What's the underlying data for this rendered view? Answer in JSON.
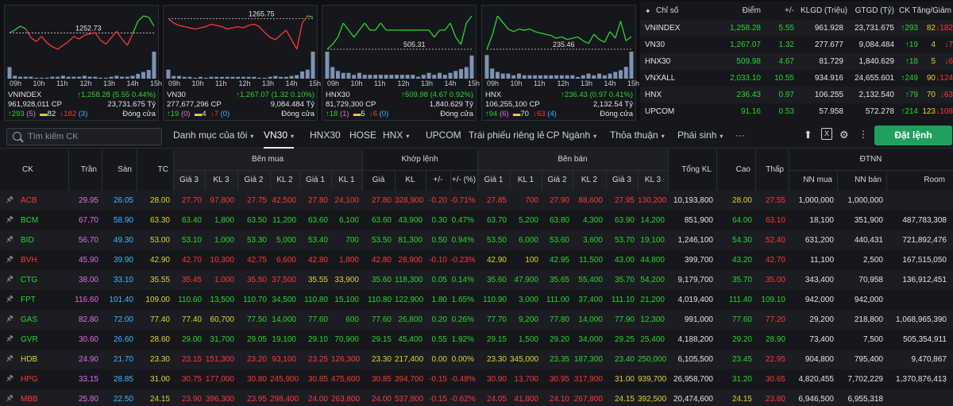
{
  "minis": [
    {
      "name": "VNINDEX",
      "line_values": [
        1252.73,
        1255,
        1258,
        1256,
        1249,
        1246,
        1250,
        1245,
        1242,
        1240,
        1243,
        1246,
        1250,
        1248,
        1251,
        1252,
        1253,
        1247,
        1244,
        1249,
        1254,
        1248,
        1243,
        1252,
        1262,
        1266,
        1265,
        1258
      ],
      "ref_value": 1252.73,
      "ref_label": "1252.73",
      "vol_values": [
        12,
        3,
        2,
        2,
        2,
        1,
        1,
        1,
        2,
        2,
        3,
        2,
        2,
        2,
        3,
        2,
        2,
        1,
        1,
        2,
        3,
        2,
        2,
        3,
        5,
        7,
        9,
        28
      ],
      "hours": [
        "09h",
        "10h",
        "11h",
        "12h",
        "13h",
        "14h",
        "15h"
      ],
      "row1_left": "VNINDEX",
      "row1_right": "↑1,258.28 (5.55 0.44%)",
      "row2_left": "961,928,011 CP",
      "row2_right": "23,731.675 Tỷ",
      "up": "↑293",
      "up_ce": "(5)",
      "ref": "82",
      "dn": "↓182",
      "dn_fl": "(3)",
      "status": "Đóng cửa"
    },
    {
      "name": "VN30",
      "line_values": [
        1265.75,
        1262,
        1260,
        1259,
        1258,
        1257,
        1258,
        1259,
        1261,
        1260,
        1259,
        1257,
        1258,
        1259,
        1258,
        1260,
        1261,
        1259,
        1254,
        1250,
        1248,
        1252,
        1256,
        1248,
        1240,
        1262,
        1268,
        1267
      ],
      "ref_value": 1265.75,
      "ref_label": "1265.75",
      "vol_values": [
        10,
        3,
        3,
        2,
        2,
        1,
        2,
        1,
        2,
        2,
        2,
        2,
        2,
        2,
        2,
        2,
        2,
        1,
        1,
        2,
        3,
        2,
        2,
        3,
        4,
        8,
        10,
        30
      ],
      "hours": [
        "09h",
        "10h",
        "11h",
        "12h",
        "13h",
        "14h",
        "15h"
      ],
      "row1_left": "VN30",
      "row1_right": "↑1,267.07 (1.32 0.10%)",
      "row2_left": "277,677,296 CP",
      "row2_right": "9,084.484 Tỷ",
      "up": "↑19",
      "up_ce": "(0)",
      "ref": "4",
      "dn": "↓7",
      "dn_fl": "(0)",
      "status": "Đóng cửa"
    },
    {
      "name": "HNX30",
      "line_values": [
        505.31,
        506,
        507,
        509,
        508,
        507,
        508,
        509,
        508,
        508,
        509,
        508,
        508,
        508,
        508,
        508,
        508,
        508,
        508,
        508,
        507,
        508,
        508,
        509,
        507,
        506,
        509,
        510
      ],
      "ref_value": 505.31,
      "ref_label": "505.31",
      "vol_values": [
        14,
        6,
        4,
        3,
        3,
        2,
        3,
        2,
        2,
        2,
        2,
        2,
        2,
        2,
        2,
        2,
        2,
        1,
        2,
        3,
        2,
        3,
        2,
        3,
        4,
        5,
        6,
        12
      ],
      "hours": [
        "09h",
        "10h",
        "11h",
        "12h",
        "13h",
        "14h",
        "15h"
      ],
      "row1_left": "HNX30",
      "row1_right": "↑509.98 (4.67 0.92%)",
      "row2_left": "81,729,300 CP",
      "row2_right": "1,840.629 Tỷ",
      "up": "↑18",
      "up_ce": "(1)",
      "ref": "5",
      "dn": "↓6",
      "dn_fl": "(0)",
      "status": "Đóng cửa"
    },
    {
      "name": "HNX",
      "line_values": [
        235.46,
        236.5,
        238,
        237.5,
        237,
        236.8,
        237,
        236.9,
        237,
        236.8,
        236.7,
        236.6,
        236.5,
        236.3,
        236.4,
        236.2,
        236.3,
        236.4,
        236.1,
        235.9,
        236.6,
        236.2,
        236,
        236.8,
        236.3,
        237.6,
        236.1,
        236.43
      ],
      "ref_value": 235.46,
      "ref_label": "235.46",
      "vol_values": [
        14,
        6,
        4,
        3,
        3,
        2,
        3,
        2,
        2,
        2,
        2,
        2,
        2,
        2,
        2,
        2,
        2,
        1,
        2,
        3,
        2,
        3,
        2,
        3,
        4,
        5,
        7,
        16
      ],
      "hours": [
        "09h",
        "10h",
        "11h",
        "12h",
        "13h",
        "14h",
        "15h"
      ],
      "row1_left": "HNX",
      "row1_right": "↑236.43 (0.97 0.41%)",
      "row2_left": "106,255,100 CP",
      "row2_right": "2,132.54 Tỷ",
      "up": "↑94",
      "up_ce": "(6)",
      "ref": "70",
      "dn": "↓63",
      "dn_fl": "(4)",
      "status": "Đóng cửa"
    }
  ],
  "summary": {
    "headers": [
      "Chỉ số",
      "Điểm",
      "+/-",
      "KLGD (Triệu)",
      "GTGD (Tỷ)",
      "CK Tăng/Giảm"
    ],
    "rows": [
      {
        "name": "VNINDEX",
        "point": "1,258.28",
        "chg": "5.55",
        "vol": "961.928",
        "val": "23,731.675",
        "up": "↑293",
        "ref": "82",
        "dn": "↓182"
      },
      {
        "name": "VN30",
        "point": "1,267.07",
        "chg": "1.32",
        "vol": "277.677",
        "val": "9,084.484",
        "up": "↑19",
        "ref": "4",
        "dn": "↓7"
      },
      {
        "name": "HNX30",
        "point": "509.98",
        "chg": "4.67",
        "vol": "81.729",
        "val": "1,840.629",
        "up": "↑18",
        "ref": "5",
        "dn": "↓6"
      },
      {
        "name": "VNXALL",
        "point": "2,033.10",
        "chg": "10.55",
        "vol": "934.916",
        "val": "24,655.601",
        "up": "↑249",
        "ref": "90",
        "dn": "↓124"
      },
      {
        "name": "HNX",
        "point": "236.43",
        "chg": "0.97",
        "vol": "106.255",
        "val": "2,132.540",
        "up": "↑79",
        "ref": "70",
        "dn": "↓63"
      },
      {
        "name": "UPCOM",
        "point": "91.16",
        "chg": "0.53",
        "vol": "57.958",
        "val": "572.278",
        "up": "↑214",
        "ref": "123",
        "dn": "↓108"
      }
    ]
  },
  "toolbar": {
    "search_placeholder": "Tìm kiếm CK",
    "tabs": [
      {
        "label": "Danh mục của tôi",
        "chev": "▾"
      },
      {
        "label": "VN30",
        "chev": "▾"
      },
      {
        "label": "HNX30",
        "chev": ""
      },
      {
        "label": "HOSE",
        "chev": ""
      },
      {
        "label": "HNX",
        "chev": "▾"
      },
      {
        "label": "UPCOM",
        "chev": ""
      },
      {
        "label": "Trái phiếu riêng lẻ",
        "chev": ""
      },
      {
        "label": "CP Ngành",
        "chev": "▾"
      },
      {
        "label": "Thỏa thuận",
        "chev": "▾"
      },
      {
        "label": "Phái sinh",
        "chev": "▾"
      },
      {
        "label": "···",
        "chev": ""
      }
    ],
    "order_label": "Đặt lệnh"
  },
  "table": {
    "groups": {
      "buy": "Bên mua",
      "match": "Khớp lệnh",
      "sell": "Bên bán",
      "foreign": "ĐTNN"
    },
    "headers": [
      "CK",
      "Trần",
      "Sàn",
      "TC",
      "Giá 3",
      "KL 3",
      "Giá 2",
      "KL 2",
      "Giá 1",
      "KL 1",
      "Giá",
      "KL",
      "+/-",
      "+/- (%)",
      "Giá 1",
      "KL 1",
      "Giá 2",
      "KL 2",
      "Giá 3",
      "KL 3",
      "Tổng KL",
      "Cao",
      "Thấp",
      "NN mua",
      "NN bán",
      "Room"
    ],
    "rows": [
      {
        "v": [
          "ACB",
          "29.95",
          "26.05",
          "28.00",
          "27.70",
          "97,800",
          "27.75",
          "42,500",
          "27.80",
          "24,100",
          "27.80",
          "328,900",
          "-0.20",
          "-0.71%",
          "27.85",
          "700",
          "27.90",
          "88,600",
          "27.95",
          "130,200",
          "10,193,800",
          "28.00",
          "27.55",
          "1,000,000",
          "1,000,000",
          ""
        ],
        "c": [
          "dn",
          "ce",
          "fl",
          "ref",
          "dn",
          "dn",
          "dn",
          "dn",
          "dn",
          "dn",
          "dn",
          "dn",
          "dn",
          "dn",
          "dn",
          "dn",
          "dn",
          "dn",
          "dn",
          "dn",
          "wh",
          "ref",
          "dn",
          "wh",
          "wh",
          "wh"
        ]
      },
      {
        "v": [
          "BCM",
          "67.70",
          "58.90",
          "63.30",
          "63.40",
          "1,800",
          "63.50",
          "11,200",
          "63.60",
          "6,100",
          "63.60",
          "43,900",
          "0.30",
          "0.47%",
          "63.70",
          "5,200",
          "63.80",
          "4,300",
          "63.90",
          "14,200",
          "851,900",
          "64.00",
          "63.10",
          "18,100",
          "351,900",
          "487,783,308"
        ],
        "c": [
          "up",
          "ce",
          "fl",
          "ref",
          "up",
          "up",
          "up",
          "up",
          "up",
          "up",
          "up",
          "up",
          "up",
          "up",
          "up",
          "up",
          "up",
          "up",
          "up",
          "up",
          "wh",
          "up",
          "dn",
          "wh",
          "wh",
          "wh"
        ]
      },
      {
        "v": [
          "BID",
          "56.70",
          "49.30",
          "53.00",
          "53.10",
          "1,000",
          "53.30",
          "5,000",
          "53.40",
          "700",
          "53.50",
          "81,300",
          "0.50",
          "0.94%",
          "53.50",
          "6,000",
          "53.60",
          "3,600",
          "53.70",
          "19,100",
          "1,246,100",
          "54.30",
          "52.40",
          "631,200",
          "440,431",
          "721,892,476"
        ],
        "c": [
          "up",
          "ce",
          "fl",
          "ref",
          "up",
          "up",
          "up",
          "up",
          "up",
          "up",
          "up",
          "up",
          "up",
          "up",
          "up",
          "up",
          "up",
          "up",
          "up",
          "up",
          "wh",
          "up",
          "dn",
          "wh",
          "wh",
          "wh"
        ]
      },
      {
        "v": [
          "BVH",
          "45.90",
          "39.90",
          "42.90",
          "42.70",
          "10,300",
          "42.75",
          "6,600",
          "42.80",
          "1,800",
          "42.80",
          "28,900",
          "-0.10",
          "-0.23%",
          "42.90",
          "100",
          "42.95",
          "11,500",
          "43.00",
          "44,800",
          "399,700",
          "43.20",
          "42.70",
          "11,100",
          "2,500",
          "167,515,050"
        ],
        "c": [
          "dn",
          "ce",
          "fl",
          "ref",
          "dn",
          "dn",
          "dn",
          "dn",
          "dn",
          "dn",
          "dn",
          "dn",
          "dn",
          "dn",
          "ref",
          "ref",
          "up",
          "up",
          "up",
          "up",
          "wh",
          "up",
          "dn",
          "wh",
          "wh",
          "wh"
        ]
      },
      {
        "v": [
          "CTG",
          "38.00",
          "33.10",
          "35.55",
          "35.45",
          "1,000",
          "35.50",
          "37,500",
          "35.55",
          "33,900",
          "35.60",
          "118,300",
          "0.05",
          "0.14%",
          "35.60",
          "47,900",
          "35.65",
          "55,400",
          "35.70",
          "54,200",
          "9,179,700",
          "35.70",
          "35.00",
          "343,400",
          "70,958",
          "136,912,451"
        ],
        "c": [
          "up",
          "ce",
          "fl",
          "ref",
          "dn",
          "dn",
          "dn",
          "dn",
          "ref",
          "ref",
          "up",
          "up",
          "up",
          "up",
          "up",
          "up",
          "up",
          "up",
          "up",
          "up",
          "wh",
          "up",
          "dn",
          "wh",
          "wh",
          "wh"
        ]
      },
      {
        "v": [
          "FPT",
          "116.60",
          "101.40",
          "109.00",
          "110.60",
          "13,500",
          "110.70",
          "34,500",
          "110.80",
          "15,100",
          "110.80",
          "122,900",
          "1.80",
          "1.65%",
          "110.90",
          "3,000",
          "111.00",
          "37,400",
          "111.10",
          "21,200",
          "4,019,400",
          "111.40",
          "109.10",
          "942,000",
          "942,000",
          ""
        ],
        "c": [
          "up",
          "ce",
          "fl",
          "ref",
          "up",
          "up",
          "up",
          "up",
          "up",
          "up",
          "up",
          "up",
          "up",
          "up",
          "up",
          "up",
          "up",
          "up",
          "up",
          "up",
          "wh",
          "up",
          "up",
          "wh",
          "wh",
          "wh"
        ]
      },
      {
        "v": [
          "GAS",
          "82.80",
          "72.00",
          "77.40",
          "77.40",
          "60,700",
          "77.50",
          "14,000",
          "77.60",
          "600",
          "77.60",
          "26,800",
          "0.20",
          "0.26%",
          "77.70",
          "9,200",
          "77.80",
          "14,000",
          "77.90",
          "12,300",
          "991,000",
          "77.60",
          "77.20",
          "29,200",
          "218,800",
          "1,068,965,390"
        ],
        "c": [
          "up",
          "ce",
          "fl",
          "ref",
          "ref",
          "ref",
          "up",
          "up",
          "up",
          "up",
          "up",
          "up",
          "up",
          "up",
          "up",
          "up",
          "up",
          "up",
          "up",
          "up",
          "wh",
          "up",
          "dn",
          "wh",
          "wh",
          "wh"
        ]
      },
      {
        "v": [
          "GVR",
          "30.60",
          "26.60",
          "28.60",
          "29.00",
          "31,700",
          "29.05",
          "19,100",
          "29.10",
          "70,900",
          "29.15",
          "45,400",
          "0.55",
          "1.92%",
          "29.15",
          "1,500",
          "29.20",
          "34,000",
          "29.25",
          "25,400",
          "4,188,200",
          "29.20",
          "28.90",
          "73,400",
          "7,500",
          "505,354,911"
        ],
        "c": [
          "up",
          "ce",
          "fl",
          "ref",
          "up",
          "up",
          "up",
          "up",
          "up",
          "up",
          "up",
          "up",
          "up",
          "up",
          "up",
          "up",
          "up",
          "up",
          "up",
          "up",
          "wh",
          "up",
          "up",
          "wh",
          "wh",
          "wh"
        ]
      },
      {
        "v": [
          "HDB",
          "24.90",
          "21.70",
          "23.30",
          "23.15",
          "151,300",
          "23.20",
          "93,100",
          "23.25",
          "126,300",
          "23.30",
          "217,400",
          "0.00",
          "0.00%",
          "23.30",
          "345,000",
          "23.35",
          "187,300",
          "23.40",
          "250,000",
          "6,105,500",
          "23.45",
          "22.95",
          "904,800",
          "795,400",
          "9,470,867"
        ],
        "c": [
          "ref",
          "ce",
          "fl",
          "ref",
          "dn",
          "dn",
          "dn",
          "dn",
          "dn",
          "dn",
          "ref",
          "ref",
          "ref",
          "ref",
          "ref",
          "ref",
          "up",
          "up",
          "up",
          "up",
          "wh",
          "up",
          "dn",
          "wh",
          "wh",
          "wh"
        ]
      },
      {
        "v": [
          "HPG",
          "33.15",
          "28.85",
          "31.00",
          "30.75",
          "177,000",
          "30.80",
          "245,900",
          "30.85",
          "475,600",
          "30.85",
          "394,700",
          "-0.15",
          "-0.48%",
          "30.90",
          "13,700",
          "30.95",
          "317,900",
          "31.00",
          "939,700",
          "26,958,700",
          "31.20",
          "30.65",
          "4,820,455",
          "7,702,229",
          "1,370,876,413"
        ],
        "c": [
          "dn",
          "ce",
          "fl",
          "ref",
          "dn",
          "dn",
          "dn",
          "dn",
          "dn",
          "dn",
          "dn",
          "dn",
          "dn",
          "dn",
          "dn",
          "dn",
          "dn",
          "dn",
          "ref",
          "ref",
          "wh",
          "up",
          "dn",
          "wh",
          "wh",
          "wh"
        ]
      },
      {
        "v": [
          "MBB",
          "25.80",
          "22.50",
          "24.15",
          "23.90",
          "396,300",
          "23.95",
          "298,400",
          "24.00",
          "263,800",
          "24.00",
          "537,800",
          "-0.15",
          "-0.62%",
          "24.05",
          "41,800",
          "24.10",
          "267,800",
          "24.15",
          "392,500",
          "20,474,600",
          "24.15",
          "23.80",
          "6,946,500",
          "6,955,318",
          ""
        ],
        "c": [
          "dn",
          "ce",
          "fl",
          "ref",
          "dn",
          "dn",
          "dn",
          "dn",
          "dn",
          "dn",
          "dn",
          "dn",
          "dn",
          "dn",
          "dn",
          "dn",
          "dn",
          "dn",
          "ref",
          "ref",
          "wh",
          "ref",
          "dn",
          "wh",
          "wh",
          "wh"
        ]
      }
    ]
  }
}
